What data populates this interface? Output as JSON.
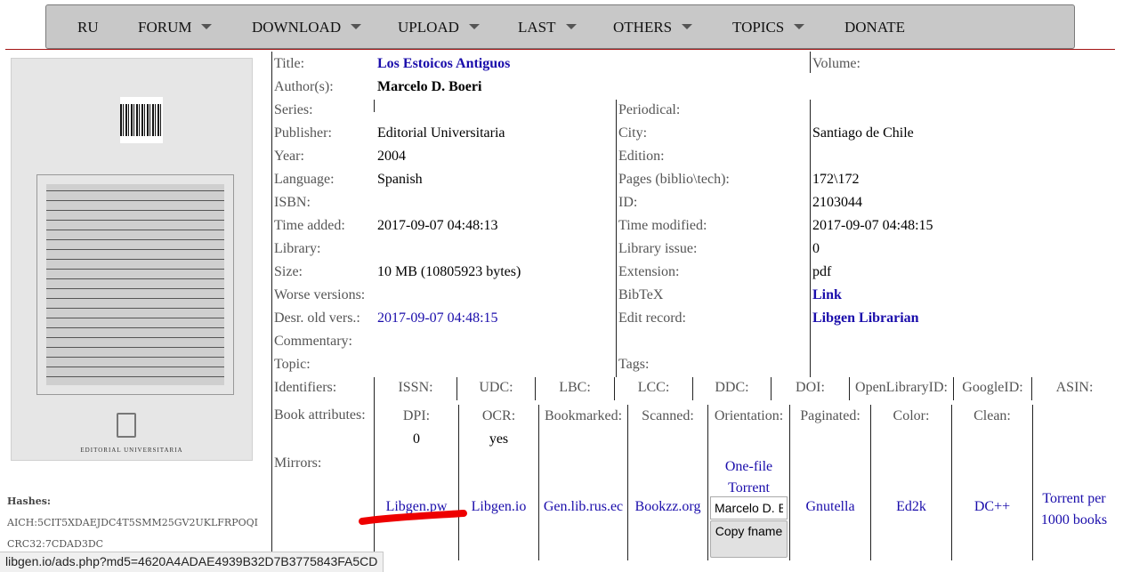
{
  "menu": {
    "items": [
      {
        "label": "RU",
        "dropdown": false
      },
      {
        "label": "FORUM",
        "dropdown": true
      },
      {
        "label": "DOWNLOAD",
        "dropdown": true
      },
      {
        "label": "UPLOAD",
        "dropdown": true
      },
      {
        "label": "LAST",
        "dropdown": true
      },
      {
        "label": "OTHERS",
        "dropdown": true
      },
      {
        "label": "TOPICS",
        "dropdown": true
      },
      {
        "label": "DONATE",
        "dropdown": false
      }
    ]
  },
  "cover": {
    "publisher_mark": "EDITORIAL UNIVERSITARIA"
  },
  "hashes": {
    "title": "Hashes:",
    "aich": "AICH:5CIT5XDAEJDC4T5SMM25GV2UKLFRPOQI",
    "crc32": "CRC32:7CDAD3DC"
  },
  "info": {
    "title_label": "Title:",
    "title_value": "Los Estoicos Antiguos",
    "volume_label": "Volume:",
    "author_label": "Author(s):",
    "author_value": "Marcelo D. Boeri",
    "series_label": "Series:",
    "periodical_label": "Periodical:",
    "publisher_label": "Publisher:",
    "publisher_value": "Editorial Universitaria",
    "city_label": "City:",
    "city_value": "Santiago de Chile",
    "year_label": "Year:",
    "year_value": "2004",
    "edition_label": "Edition:",
    "language_label": "Language:",
    "language_value": "Spanish",
    "pages_label": "Pages (biblio\\tech):",
    "pages_value": "172\\172",
    "isbn_label": "ISBN:",
    "id_label": "ID:",
    "id_value": "2103044",
    "time_added_label": "Time added:",
    "time_added_value": "2017-09-07 04:48:13",
    "time_modified_label": "Time modified:",
    "time_modified_value": "2017-09-07 04:48:15",
    "library_label": "Library:",
    "library_issue_label": "Library issue:",
    "library_issue_value": "0",
    "size_label": "Size:",
    "size_value": "10 MB (10805923 bytes)",
    "extension_label": "Extension:",
    "extension_value": "pdf",
    "worse_label": "Worse versions:",
    "bibtex_label": "BibTeX",
    "bibtex_value": "Link",
    "desr_label": "Desr. old vers.:",
    "desr_value": "2017-09-07 04:48:15",
    "edit_label": "Edit record:",
    "edit_value": "Libgen Librarian",
    "commentary_label": "Commentary:",
    "topic_label": "Topic:",
    "tags_label": "Tags:",
    "identifiers_label": "Identifiers:",
    "identifiers": [
      "ISSN:",
      "UDC:",
      "LBC:",
      "LCC:",
      "DDC:",
      "DOI:",
      "OpenLibraryID:",
      "GoogleID:",
      "ASIN:"
    ],
    "attributes_label": "Book attributes:",
    "attributes": [
      {
        "name": "DPI:",
        "value": "0"
      },
      {
        "name": "OCR:",
        "value": "yes"
      },
      {
        "name": "Bookmarked:",
        "value": ""
      },
      {
        "name": "Scanned:",
        "value": ""
      },
      {
        "name": "Orientation:",
        "value": ""
      },
      {
        "name": "Paginated:",
        "value": ""
      },
      {
        "name": "Color:",
        "value": ""
      },
      {
        "name": "Clean:",
        "value": ""
      }
    ],
    "mirrors_label": "Mirrors:"
  },
  "mirrors": {
    "libgen_pw": "Libgen.pw",
    "libgen_io": "Libgen.io",
    "gen_lib": "Gen.lib.rus.ec",
    "bookzz": "Bookzz.org",
    "one_file_torrent": "One-file Torrent",
    "filename_value": "Marcelo D. Boeri - Los Estoicos Antiguos.pdf",
    "copy_button": "Copy fname",
    "gnutella": "Gnutella",
    "ed2k": "Ed2k",
    "dcpp": "DC++",
    "torrent_per_1000": "Torrent per 1000 books"
  },
  "annotation": {
    "underline_color": "#ee0000"
  },
  "status_bar": {
    "url": "libgen.io/ads.php?md5=4620A4ADAE4939B32D7B3775843FA5CD"
  }
}
